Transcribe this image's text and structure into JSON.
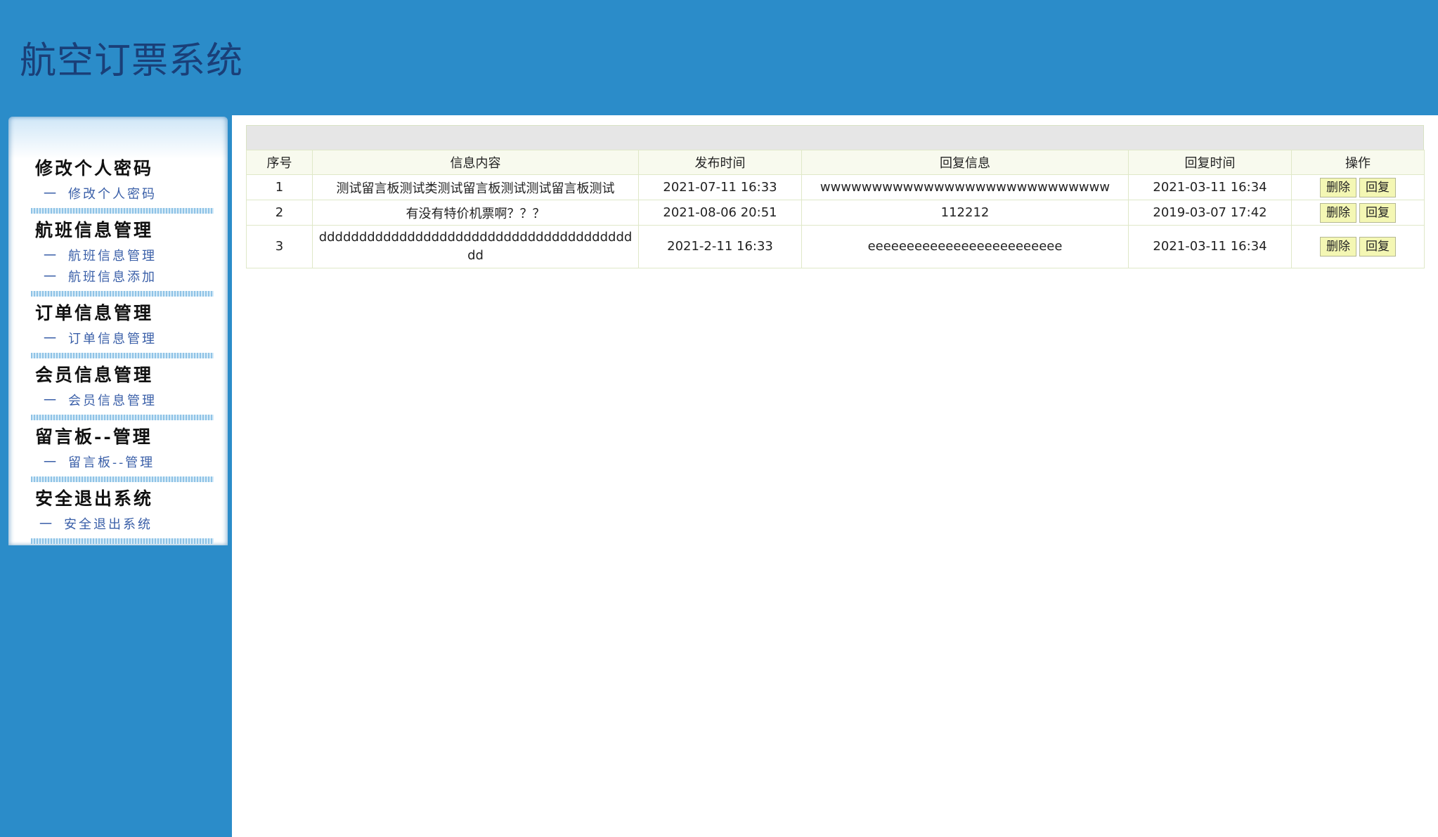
{
  "header": {
    "title": "航空订票系统"
  },
  "sidebar": {
    "groups": [
      {
        "heading": "修改个人密码",
        "items": [
          {
            "dash": "一",
            "label": "修改个人密码"
          }
        ]
      },
      {
        "heading": "航班信息管理",
        "items": [
          {
            "dash": "一",
            "label": "航班信息管理"
          },
          {
            "dash": "一",
            "label": "航班信息添加"
          }
        ]
      },
      {
        "heading": "订单信息管理",
        "items": [
          {
            "dash": "一",
            "label": "订单信息管理"
          }
        ]
      },
      {
        "heading": "会员信息管理",
        "items": [
          {
            "dash": "一",
            "label": "会员信息管理"
          }
        ]
      },
      {
        "heading": "留言板--管理",
        "items": [
          {
            "dash": "一",
            "label": "留言板--管理"
          }
        ]
      },
      {
        "heading": "安全退出系统",
        "items": [
          {
            "dash": "一",
            "label": "安全退出系统"
          }
        ]
      }
    ]
  },
  "table": {
    "columns": [
      "序号",
      "信息内容",
      "发布时间",
      "回复信息",
      "回复时间",
      "操作"
    ],
    "rows": [
      {
        "no": "1",
        "content": "测试留言板测试类测试留言板测试测试留言板测试",
        "post_time": "2021-07-11 16:33",
        "reply": "wwwwwwwwwwwwwwwwwwwwwwwwwwww",
        "reply_time": "2021-03-11 16:34",
        "delete_label": "删除",
        "reply_label": "回复"
      },
      {
        "no": "2",
        "content": "有没有特价机票啊？？？",
        "post_time": "2021-08-06 20:51",
        "reply": "112212",
        "reply_time": "2019-03-07 17:42",
        "delete_label": "删除",
        "reply_label": "回复"
      },
      {
        "no": "3",
        "content": "ddddddddddddddddddddddddddddddddddddddddd",
        "post_time": "2021-2-11 16:33",
        "reply": "eeeeeeeeeeeeeeeeeeeeeeeee",
        "reply_time": "2021-03-11 16:34",
        "delete_label": "删除",
        "reply_label": "回复"
      }
    ]
  },
  "colors": {
    "background": "#2b8cc9",
    "title": "#1a3f78",
    "menu_link": "#3a5fa8",
    "button": "#f4f7b4"
  }
}
